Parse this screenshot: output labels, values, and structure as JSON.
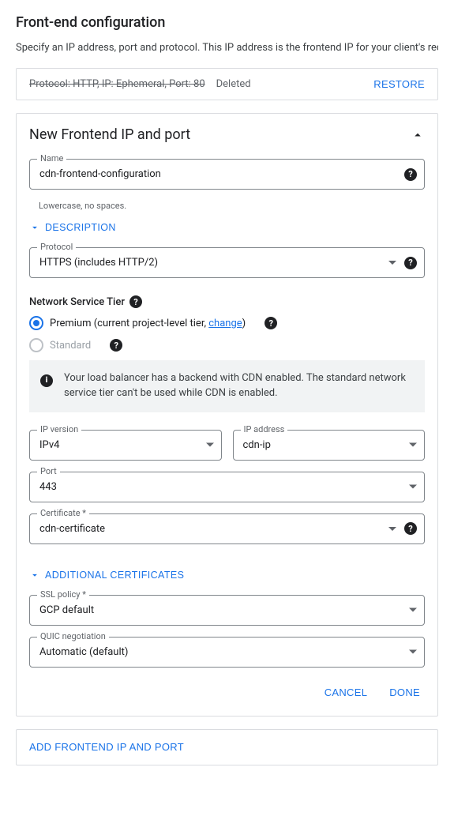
{
  "header": {
    "title": "Front-end configuration",
    "subtitle": "Specify an IP address, port and protocol. This IP address is the frontend IP for your client's reques"
  },
  "deleted": {
    "summary": "Protocol: HTTP, IP: Ephemeral, Port: 80",
    "status": "Deleted",
    "restore": "RESTORE"
  },
  "panel": {
    "title": "New Frontend IP and port",
    "name": {
      "label": "Name",
      "value": "cdn-frontend-configuration",
      "hint": "Lowercase, no spaces."
    },
    "description_expander": "DESCRIPTION",
    "protocol": {
      "label": "Protocol",
      "value": "HTTPS (includes HTTP/2)"
    },
    "tier": {
      "label": "Network Service Tier",
      "premium": {
        "prefix": "Premium (current project-level tier, ",
        "link": "change",
        "suffix": ")"
      },
      "standard": "Standard"
    },
    "cdn_notice": "Your load balancer has a backend with CDN enabled. The standard network service tier can't be used while CDN is enabled.",
    "ipversion": {
      "label": "IP version",
      "value": "IPv4"
    },
    "ipaddress": {
      "label": "IP address",
      "value": "cdn-ip"
    },
    "port": {
      "label": "Port",
      "value": "443"
    },
    "certificate": {
      "label": "Certificate *",
      "value": "cdn-certificate"
    },
    "addl_certs_expander": "ADDITIONAL CERTIFICATES",
    "sslpolicy": {
      "label": "SSL policy *",
      "value": "GCP default"
    },
    "quic": {
      "label": "QUIC negotiation",
      "value": "Automatic (default)"
    },
    "actions": {
      "cancel": "CANCEL",
      "done": "DONE"
    }
  },
  "add_button": "ADD FRONTEND IP AND PORT"
}
